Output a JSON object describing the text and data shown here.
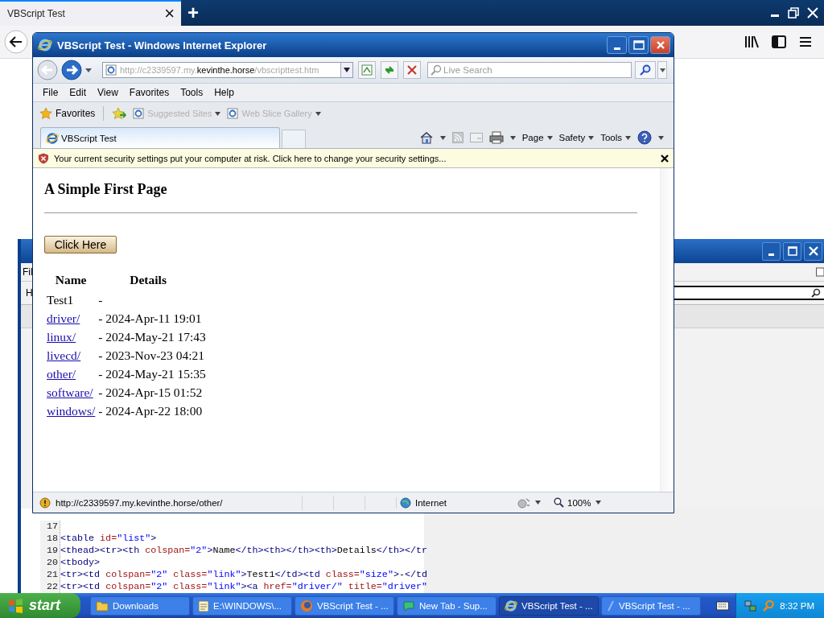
{
  "browser": {
    "tab": {
      "title": "VBScript Test",
      "close": "×"
    },
    "new_tab": "+"
  },
  "editor": {
    "menu": "Fil",
    "toolbar_label": "H",
    "code": [
      {
        "number": "17"
      },
      {
        "number": "18",
        "text": "<table id=\"list\">"
      },
      {
        "number": "19",
        "text": "<thead><tr><th colspan=\"2\">Name</th><th></th><th>Details</th></tr"
      },
      {
        "number": "20",
        "text": "<tbody>"
      },
      {
        "number": "21",
        "text": "<tr><td colspan=\"2\" class=\"link\">Test1</td><td class=\"size\">-</td"
      },
      {
        "number": "22",
        "text": "<tr><td colspan=\"2\" class=\"link\"><a href=\"driver/\" title=\"driver\""
      }
    ]
  },
  "ie": {
    "title": "VBScript Test - Windows Internet Explorer",
    "address": {
      "before": "http://c2339597.my.",
      "domain": "kevinthe.horse",
      "after": "/vbscripttest.htm"
    },
    "search_placeholder": "Live Search",
    "menu": [
      "File",
      "Edit",
      "View",
      "Favorites",
      "Tools",
      "Help"
    ],
    "favorites": {
      "label": "Favorites",
      "links": [
        {
          "label": "Suggested Sites",
          "disabled": true
        },
        {
          "label": "Web Slice Gallery",
          "disabled": true
        }
      ]
    },
    "tab": {
      "title": "VBScript Test"
    },
    "commands": [
      "Page",
      "Safety",
      "Tools"
    ],
    "infobar": "Your current security settings put your computer at risk. Click here to change your security settings...",
    "page": {
      "heading": "A Simple First Page",
      "button": "Click Here",
      "columns": [
        "Name",
        "Details"
      ],
      "rows": [
        {
          "name": "Test1",
          "link": false,
          "details": "-"
        },
        {
          "name": "driver/",
          "link": true,
          "details": "- 2024-Apr-11 19:01"
        },
        {
          "name": "linux/",
          "link": true,
          "details": "- 2024-May-21 17:43"
        },
        {
          "name": "livecd/",
          "link": true,
          "details": "- 2023-Nov-23 04:21"
        },
        {
          "name": "other/",
          "link": true,
          "details": "- 2024-May-21 15:35"
        },
        {
          "name": "software/",
          "link": true,
          "details": "- 2024-Apr-15 01:52"
        },
        {
          "name": "windows/",
          "link": true,
          "details": "- 2024-Apr-22 18:00"
        }
      ]
    },
    "status": {
      "url": "http://c2339597.my.kevinthe.horse/other/",
      "zone": "Internet",
      "zoom": "100%"
    }
  },
  "taskbar": {
    "start": "start",
    "items": [
      {
        "label": "Downloads",
        "kind": "folder",
        "selected": false
      },
      {
        "label": "E:\\WINDOWS\\...",
        "kind": "notepad",
        "selected": false
      },
      {
        "label": "VBScript Test - ...",
        "kind": "fox",
        "selected": false
      },
      {
        "label": "New Tab - Sup...",
        "kind": "bubble",
        "selected": false
      },
      {
        "label": "VBScript Test - ...",
        "kind": "ie",
        "selected": true
      },
      {
        "label": "VBScript Test - ...",
        "kind": "editor",
        "selected": false
      }
    ],
    "clock": "8:32 PM"
  }
}
